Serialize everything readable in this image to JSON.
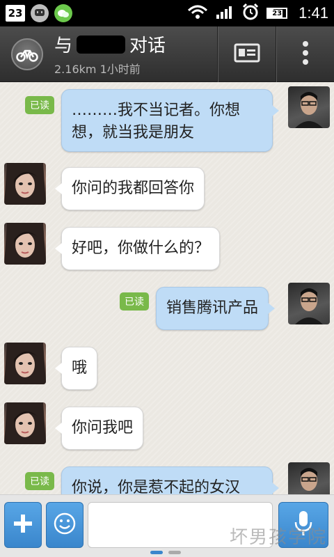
{
  "status_bar": {
    "calendar_day": "23",
    "battery_level": "23",
    "time": "1:41",
    "icons": [
      "calendar-icon",
      "messenger-icon",
      "wechat-icon",
      "wifi-icon",
      "signal-icon",
      "alarm-icon",
      "battery-icon"
    ]
  },
  "header": {
    "title_prefix": "与",
    "title_suffix": "对话",
    "subtitle": "2.16km 1小时前",
    "avatar_icon": "bicycle-icon",
    "profile_button_icon": "profile-card-icon",
    "menu_button_icon": "more-vertical-icon"
  },
  "messages": [
    {
      "from": "me",
      "text": "………我不当记者。你想想，就当我是朋友",
      "read_label": "已读"
    },
    {
      "from": "her",
      "text": "你问的我都回答你"
    },
    {
      "from": "her",
      "text": "好吧，你做什么的？"
    },
    {
      "from": "me",
      "text": "销售腾讯产品",
      "read_label": "已读"
    },
    {
      "from": "her",
      "text": "哦"
    },
    {
      "from": "her",
      "text": "你问我吧"
    },
    {
      "from": "me",
      "text": "你说，你是惹不起的女汉",
      "read_label": "已读"
    }
  ],
  "input_bar": {
    "plus_icon": "plus-icon",
    "emoji_icon": "smiley-icon",
    "mic_icon": "microphone-icon",
    "text_value": "",
    "placeholder": ""
  },
  "watermark": "坏男孩学院",
  "colors": {
    "bubble_me": "#bfdcf6",
    "bubble_her": "#ffffff",
    "read_badge": "#79b94a",
    "accent": "#3a86cc"
  }
}
